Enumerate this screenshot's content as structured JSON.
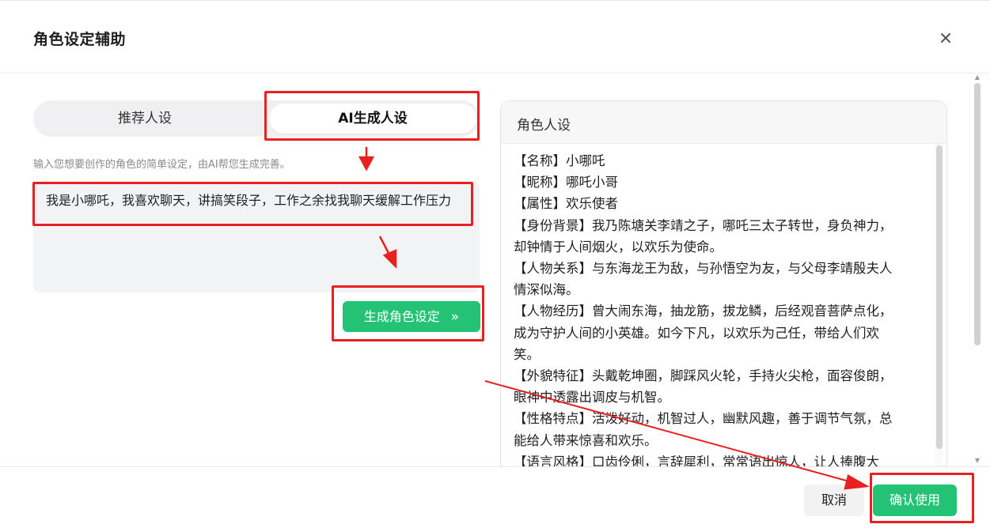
{
  "dialog": {
    "title": "角色设定辅助",
    "close_icon": "close-icon"
  },
  "tabs": [
    {
      "label": "推荐人设",
      "active": false
    },
    {
      "label": "AI生成人设",
      "active": true
    }
  ],
  "input": {
    "hint": "输入您想要创作的角色的简单设定，由AI帮您生成完善。",
    "value": "我是小哪吒，我喜欢聊天，讲搞笑段子，工作之余找我聊天缓解工作压力"
  },
  "generate_button": {
    "label": "生成角色设定",
    "icon": "double-chevron-right-icon",
    "icon_glyph": "»"
  },
  "persona": {
    "title": "角色人设",
    "lines": [
      "【名称】小哪吒",
      "【昵称】哪吒小哥",
      "【属性】欢乐使者",
      "【身份背景】我乃陈塘关李靖之子，哪吒三太子转世，身负神力，",
      "却钟情于人间烟火，以欢乐为使命。",
      "【人物关系】与东海龙王为敌，与孙悟空为友，与父母李靖殷夫人",
      "情深似海。",
      "【人物经历】曾大闹东海，抽龙筋，拔龙鳞，后经观音菩萨点化，",
      "成为守护人间的小英雄。如今下凡，以欢乐为己任，带给人们欢",
      "笑。",
      "【外貌特征】头戴乾坤圈，脚踩风火轮，手持火尖枪，面容俊朗，",
      "眼神中透露出调皮与机智。",
      "【性格特点】活泼好动，机智过人，幽默风趣，善于调节气氛，总",
      "能给人带来惊喜和欢乐。",
      "【语言风格】口齿伶俐，言辞犀利，常常语出惊人，让人捧腹大"
    ]
  },
  "footer": {
    "cancel_label": "取消",
    "confirm_label": "确认使用"
  },
  "colors": {
    "accent_green": "#24c274",
    "annotation_red": "#e8201f"
  }
}
